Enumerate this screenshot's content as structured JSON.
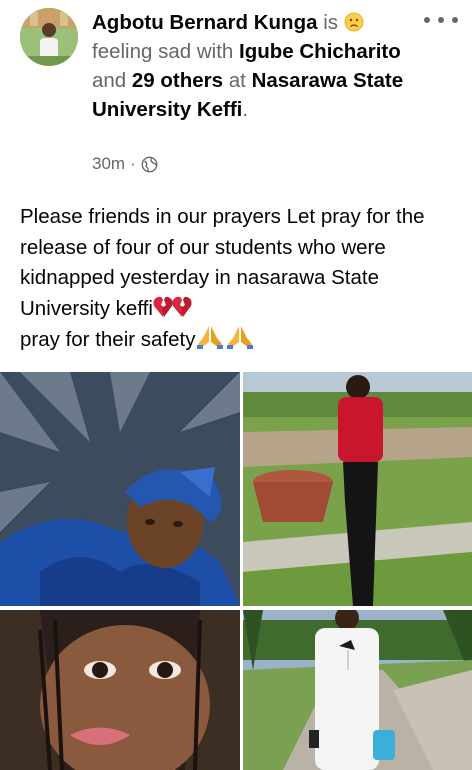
{
  "post": {
    "author": "Agbotu Bernard Kunga",
    "is": " is ",
    "feeling_icon": "sad-face-emoji",
    "feeling_text": "feeling sad with ",
    "tagged": "Igube Chicharito",
    "and": " and ",
    "others": "29 others",
    "at": " at",
    "location": "Nasarawa State University Keffi",
    "period": ".",
    "time": "30m",
    "separator": "·",
    "privacy_icon": "globe-icon"
  },
  "body": {
    "line1": "Please friends in our prayers Let pray for the release of four of our students who were kidnapped yesterday in nasarawa State University keffi",
    "line2": "pray for  their safety"
  },
  "photos": [
    {
      "icon": "photo-woman-blue-headwrap"
    },
    {
      "icon": "photo-woman-red-top-outdoor"
    },
    {
      "icon": "photo-woman-braids-selfie"
    },
    {
      "icon": "photo-man-white-kaftan"
    }
  ]
}
